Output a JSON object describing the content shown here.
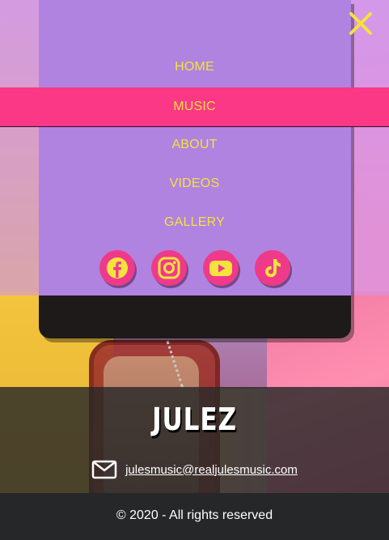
{
  "nav": {
    "items": [
      {
        "label": "HOME",
        "active": false
      },
      {
        "label": "MUSIC",
        "active": true
      },
      {
        "label": "ABOUT",
        "active": false
      },
      {
        "label": "VIDEOS",
        "active": false
      },
      {
        "label": "GALLERY",
        "active": false
      }
    ],
    "close_icon": "close-x-icon"
  },
  "social": [
    {
      "name": "facebook",
      "icon": "facebook-icon"
    },
    {
      "name": "instagram",
      "icon": "instagram-icon"
    },
    {
      "name": "youtube",
      "icon": "youtube-icon"
    },
    {
      "name": "tiktok",
      "icon": "tiktok-icon"
    }
  ],
  "footer": {
    "brand": "JULEZ",
    "email": "julesmusic@realjulesmusic.com",
    "copyright": "© 2020 - All rights reserved"
  },
  "colors": {
    "accent_pink": "#fb3886",
    "menu_text": "#f5e23c",
    "menu_bg": "#b083e0"
  }
}
